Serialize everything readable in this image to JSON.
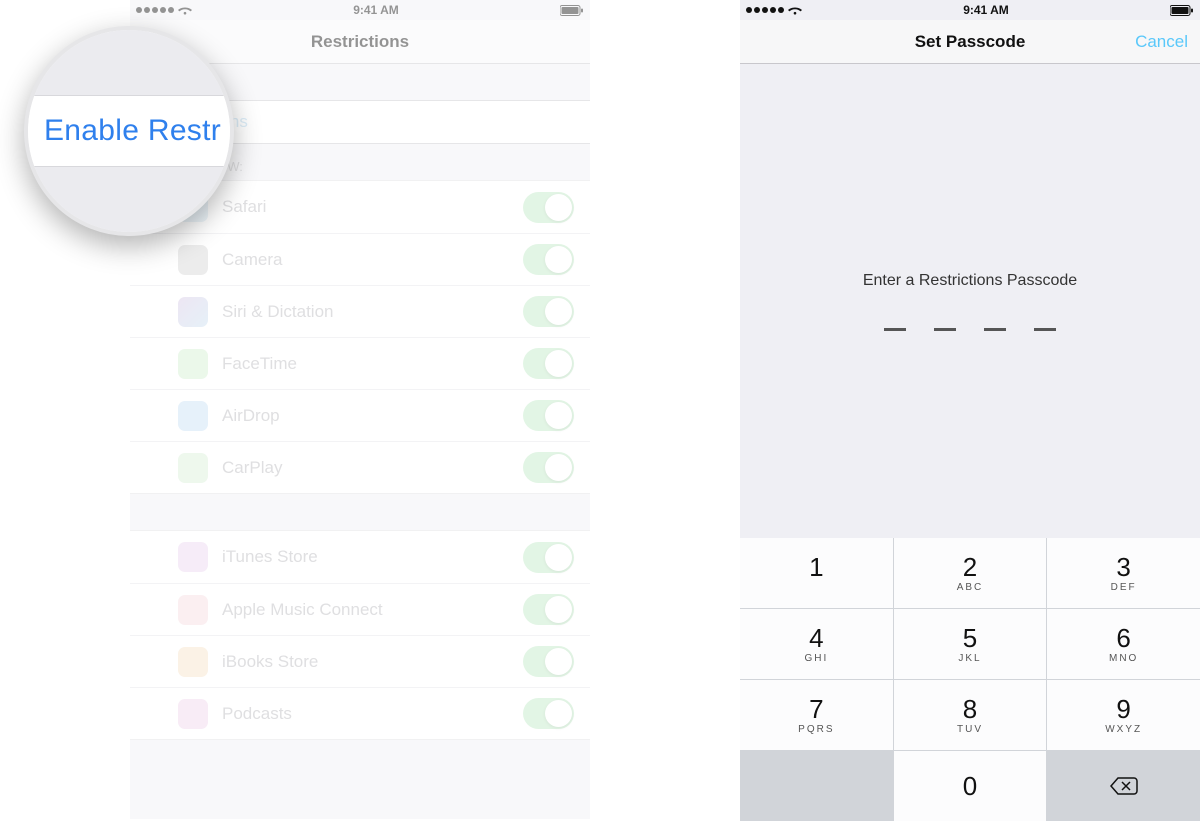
{
  "status": {
    "time": "9:41 AM"
  },
  "left": {
    "title": "Restrictions",
    "enable_action": "Enable Restrictions",
    "magnified_text": "Enable Restr",
    "enable_trailing_text": "rictions",
    "section_allow": "ALLOW:",
    "items_group1": [
      {
        "label": "Safari",
        "iconClass": "ic-safari"
      },
      {
        "label": "Camera",
        "iconClass": "ic-camera"
      },
      {
        "label": "Siri & Dictation",
        "iconClass": "ic-siri"
      },
      {
        "label": "FaceTime",
        "iconClass": "ic-facetime"
      },
      {
        "label": "AirDrop",
        "iconClass": "ic-airdrop"
      },
      {
        "label": "CarPlay",
        "iconClass": "ic-carplay"
      }
    ],
    "items_group2": [
      {
        "label": "iTunes Store",
        "iconClass": "ic-itunes"
      },
      {
        "label": "Apple Music Connect",
        "iconClass": "ic-music"
      },
      {
        "label": "iBooks Store",
        "iconClass": "ic-ibooks"
      },
      {
        "label": "Podcasts",
        "iconClass": "ic-podcasts"
      }
    ]
  },
  "right": {
    "title": "Set Passcode",
    "cancel": "Cancel",
    "prompt": "Enter a Restrictions Passcode",
    "keys": [
      {
        "num": "1",
        "letters": ""
      },
      {
        "num": "2",
        "letters": "ABC"
      },
      {
        "num": "3",
        "letters": "DEF"
      },
      {
        "num": "4",
        "letters": "GHI"
      },
      {
        "num": "5",
        "letters": "JKL"
      },
      {
        "num": "6",
        "letters": "MNO"
      },
      {
        "num": "7",
        "letters": "PQRS"
      },
      {
        "num": "8",
        "letters": "TUV"
      },
      {
        "num": "9",
        "letters": "WXYZ"
      }
    ],
    "zero": "0"
  }
}
